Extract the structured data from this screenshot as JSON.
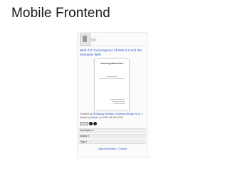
{
  "slide": {
    "title": "Mobile Frontend"
  },
  "page": {
    "heading": "Web 2.0: Convergence of Web 2.0 and the Semantic Web",
    "document": {
      "title": "Technology Watch Report",
      "subtitle": "..."
    },
    "meta": {
      "line1_prefix": "Created by",
      "authors": "Wolfgang Wahlster, Andreas Dengel et al.",
      "line1_suffix": "»",
      "line2_prefix": "Added by",
      "added_by": "Martin",
      "added_date": "on 2001-08-08 07:00"
    },
    "license": {
      "label": "cc",
      "icons": [
        "by",
        "nc"
      ]
    },
    "sections": [
      "Description ▾",
      "Details ▾",
      "Tags ▾"
    ],
    "footer": {
      "legal": "Legal Information",
      "separator": "•",
      "contact": "Contact"
    }
  },
  "colors": {
    "link": "#2a56c8",
    "bar": "#eeeeee"
  }
}
